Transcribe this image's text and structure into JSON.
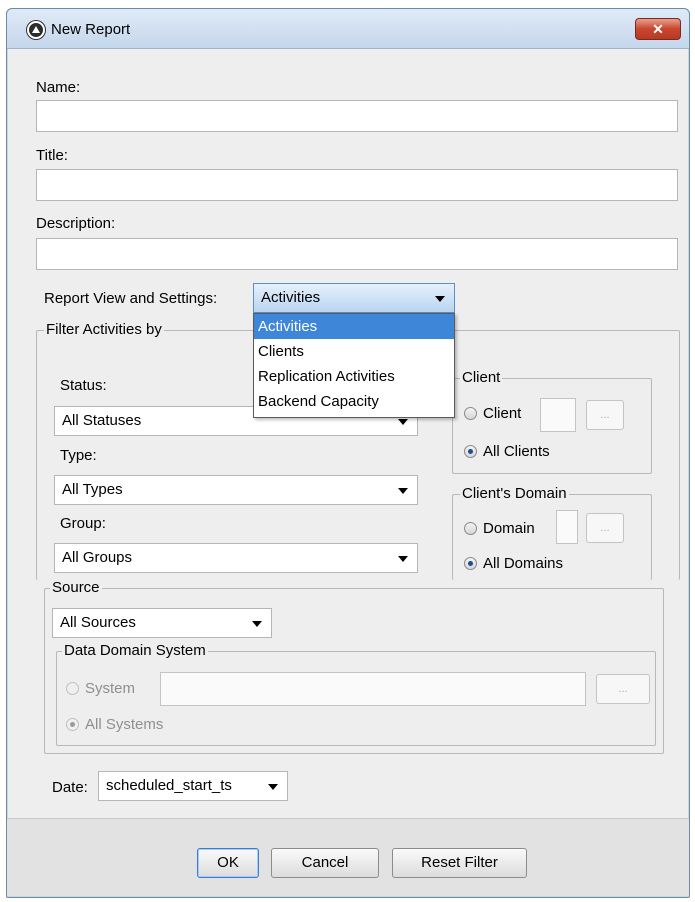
{
  "window": {
    "title": "New Report",
    "close_label": "✕"
  },
  "fields": {
    "name_label": "Name:",
    "name_value": "",
    "title_label": "Title:",
    "title_value": "",
    "description_label": "Description:",
    "description_value": ""
  },
  "report_view": {
    "label": "Report View and Settings:",
    "selected": "Activities",
    "options": [
      "Activities",
      "Clients",
      "Replication Activities",
      "Backend Capacity"
    ]
  },
  "filter": {
    "legend": "Filter Activities by",
    "status_label": "Status:",
    "status_value": "All Statuses",
    "type_label": "Type:",
    "type_value": "All Types",
    "group_label": "Group:",
    "group_value": "All Groups"
  },
  "client_group": {
    "legend": "Client",
    "client_radio": "Client",
    "all_clients_radio": "All Clients",
    "browse": "..."
  },
  "domain_group": {
    "legend": "Client's Domain",
    "domain_radio": "Domain",
    "all_domains_radio": "All Domains",
    "browse": "..."
  },
  "source": {
    "legend": "Source",
    "value": "All Sources"
  },
  "dds": {
    "legend": "Data Domain System",
    "system_radio": "System",
    "all_systems_radio": "All Systems",
    "system_value": "",
    "browse": "..."
  },
  "date": {
    "label": "Date:",
    "value": "scheduled_start_ts"
  },
  "buttons": {
    "ok": "OK",
    "cancel": "Cancel",
    "reset": "Reset Filter"
  },
  "colors": {
    "selection": "#3d86d8",
    "close_button": "#c8452f",
    "dialog_bg": "#eeeeee"
  }
}
